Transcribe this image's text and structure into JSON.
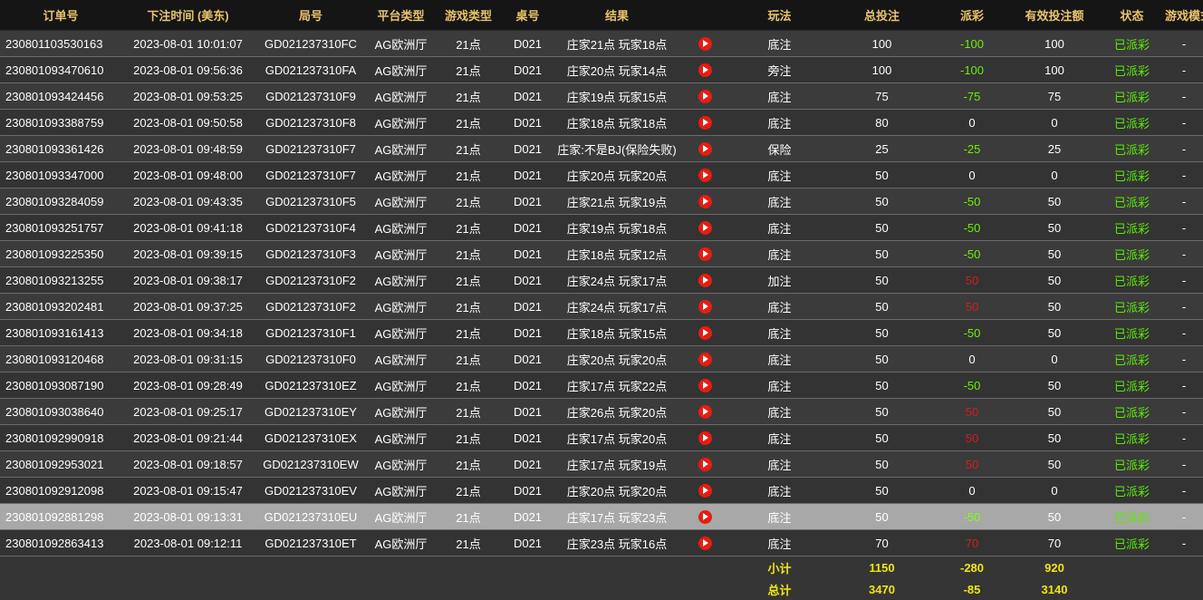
{
  "headers": {
    "order_id": "订单号",
    "bet_time": "下注时间 (美东)",
    "round_id": "局号",
    "platform": "平台类型",
    "game_type": "游戏类型",
    "table_no": "桌号",
    "result": "结果",
    "play": "玩法",
    "total_bet": "总投注",
    "payout": "派彩",
    "valid_bet": "有效投注额",
    "status": "状态",
    "game_mode": "游戏模式"
  },
  "rows": [
    {
      "order_id": "230801103530163",
      "bet_time": "2023-08-01 10:01:07",
      "round_id": "GD021237310FC",
      "platform": "AG欧洲厅",
      "game_type": "21点",
      "table_no": "D021",
      "result": "庄家21点 玩家18点",
      "play": "底注",
      "total_bet": "100",
      "payout": "-100",
      "payout_kind": "green",
      "valid_bet": "100",
      "status": "已派彩",
      "game_mode": "-"
    },
    {
      "order_id": "230801093470610",
      "bet_time": "2023-08-01 09:56:36",
      "round_id": "GD021237310FA",
      "platform": "AG欧洲厅",
      "game_type": "21点",
      "table_no": "D021",
      "result": "庄家20点 玩家14点",
      "play": "旁注",
      "total_bet": "100",
      "payout": "-100",
      "payout_kind": "green",
      "valid_bet": "100",
      "status": "已派彩",
      "game_mode": "-"
    },
    {
      "order_id": "230801093424456",
      "bet_time": "2023-08-01 09:53:25",
      "round_id": "GD021237310F9",
      "platform": "AG欧洲厅",
      "game_type": "21点",
      "table_no": "D021",
      "result": "庄家19点 玩家15点",
      "play": "底注",
      "total_bet": "75",
      "payout": "-75",
      "payout_kind": "green",
      "valid_bet": "75",
      "status": "已派彩",
      "game_mode": "-"
    },
    {
      "order_id": "230801093388759",
      "bet_time": "2023-08-01 09:50:58",
      "round_id": "GD021237310F8",
      "platform": "AG欧洲厅",
      "game_type": "21点",
      "table_no": "D021",
      "result": "庄家18点 玩家18点",
      "play": "底注",
      "total_bet": "80",
      "payout": "0",
      "payout_kind": "zero",
      "valid_bet": "0",
      "status": "已派彩",
      "game_mode": "-"
    },
    {
      "order_id": "230801093361426",
      "bet_time": "2023-08-01 09:48:59",
      "round_id": "GD021237310F7",
      "platform": "AG欧洲厅",
      "game_type": "21点",
      "table_no": "D021",
      "result": "庄家:不是BJ(保险失败)",
      "play": "保险",
      "total_bet": "25",
      "payout": "-25",
      "payout_kind": "green",
      "valid_bet": "25",
      "status": "已派彩",
      "game_mode": "-"
    },
    {
      "order_id": "230801093347000",
      "bet_time": "2023-08-01 09:48:00",
      "round_id": "GD021237310F7",
      "platform": "AG欧洲厅",
      "game_type": "21点",
      "table_no": "D021",
      "result": "庄家20点 玩家20点",
      "play": "底注",
      "total_bet": "50",
      "payout": "0",
      "payout_kind": "zero",
      "valid_bet": "0",
      "status": "已派彩",
      "game_mode": "-"
    },
    {
      "order_id": "230801093284059",
      "bet_time": "2023-08-01 09:43:35",
      "round_id": "GD021237310F5",
      "platform": "AG欧洲厅",
      "game_type": "21点",
      "table_no": "D021",
      "result": "庄家21点 玩家19点",
      "play": "底注",
      "total_bet": "50",
      "payout": "-50",
      "payout_kind": "green",
      "valid_bet": "50",
      "status": "已派彩",
      "game_mode": "-"
    },
    {
      "order_id": "230801093251757",
      "bet_time": "2023-08-01 09:41:18",
      "round_id": "GD021237310F4",
      "platform": "AG欧洲厅",
      "game_type": "21点",
      "table_no": "D021",
      "result": "庄家19点 玩家18点",
      "play": "底注",
      "total_bet": "50",
      "payout": "-50",
      "payout_kind": "green",
      "valid_bet": "50",
      "status": "已派彩",
      "game_mode": "-"
    },
    {
      "order_id": "230801093225350",
      "bet_time": "2023-08-01 09:39:15",
      "round_id": "GD021237310F3",
      "platform": "AG欧洲厅",
      "game_type": "21点",
      "table_no": "D021",
      "result": "庄家18点 玩家12点",
      "play": "底注",
      "total_bet": "50",
      "payout": "-50",
      "payout_kind": "green",
      "valid_bet": "50",
      "status": "已派彩",
      "game_mode": "-"
    },
    {
      "order_id": "230801093213255",
      "bet_time": "2023-08-01 09:38:17",
      "round_id": "GD021237310F2",
      "platform": "AG欧洲厅",
      "game_type": "21点",
      "table_no": "D021",
      "result": "庄家24点 玩家17点",
      "play": "加注",
      "total_bet": "50",
      "payout": "50",
      "payout_kind": "red",
      "valid_bet": "50",
      "status": "已派彩",
      "game_mode": "-"
    },
    {
      "order_id": "230801093202481",
      "bet_time": "2023-08-01 09:37:25",
      "round_id": "GD021237310F2",
      "platform": "AG欧洲厅",
      "game_type": "21点",
      "table_no": "D021",
      "result": "庄家24点 玩家17点",
      "play": "底注",
      "total_bet": "50",
      "payout": "50",
      "payout_kind": "red",
      "valid_bet": "50",
      "status": "已派彩",
      "game_mode": "-"
    },
    {
      "order_id": "230801093161413",
      "bet_time": "2023-08-01 09:34:18",
      "round_id": "GD021237310F1",
      "platform": "AG欧洲厅",
      "game_type": "21点",
      "table_no": "D021",
      "result": "庄家18点 玩家15点",
      "play": "底注",
      "total_bet": "50",
      "payout": "-50",
      "payout_kind": "green",
      "valid_bet": "50",
      "status": "已派彩",
      "game_mode": "-"
    },
    {
      "order_id": "230801093120468",
      "bet_time": "2023-08-01 09:31:15",
      "round_id": "GD021237310F0",
      "platform": "AG欧洲厅",
      "game_type": "21点",
      "table_no": "D021",
      "result": "庄家20点 玩家20点",
      "play": "底注",
      "total_bet": "50",
      "payout": "0",
      "payout_kind": "zero",
      "valid_bet": "0",
      "status": "已派彩",
      "game_mode": "-"
    },
    {
      "order_id": "230801093087190",
      "bet_time": "2023-08-01 09:28:49",
      "round_id": "GD021237310EZ",
      "platform": "AG欧洲厅",
      "game_type": "21点",
      "table_no": "D021",
      "result": "庄家17点 玩家22点",
      "play": "底注",
      "total_bet": "50",
      "payout": "-50",
      "payout_kind": "green",
      "valid_bet": "50",
      "status": "已派彩",
      "game_mode": "-"
    },
    {
      "order_id": "230801093038640",
      "bet_time": "2023-08-01 09:25:17",
      "round_id": "GD021237310EY",
      "platform": "AG欧洲厅",
      "game_type": "21点",
      "table_no": "D021",
      "result": "庄家26点 玩家20点",
      "play": "底注",
      "total_bet": "50",
      "payout": "50",
      "payout_kind": "red",
      "valid_bet": "50",
      "status": "已派彩",
      "game_mode": "-"
    },
    {
      "order_id": "230801092990918",
      "bet_time": "2023-08-01 09:21:44",
      "round_id": "GD021237310EX",
      "platform": "AG欧洲厅",
      "game_type": "21点",
      "table_no": "D021",
      "result": "庄家17点 玩家20点",
      "play": "底注",
      "total_bet": "50",
      "payout": "50",
      "payout_kind": "red",
      "valid_bet": "50",
      "status": "已派彩",
      "game_mode": "-"
    },
    {
      "order_id": "230801092953021",
      "bet_time": "2023-08-01 09:18:57",
      "round_id": "GD021237310EW",
      "platform": "AG欧洲厅",
      "game_type": "21点",
      "table_no": "D021",
      "result": "庄家17点 玩家19点",
      "play": "底注",
      "total_bet": "50",
      "payout": "50",
      "payout_kind": "red",
      "valid_bet": "50",
      "status": "已派彩",
      "game_mode": "-"
    },
    {
      "order_id": "230801092912098",
      "bet_time": "2023-08-01 09:15:47",
      "round_id": "GD021237310EV",
      "platform": "AG欧洲厅",
      "game_type": "21点",
      "table_no": "D021",
      "result": "庄家20点 玩家20点",
      "play": "底注",
      "total_bet": "50",
      "payout": "0",
      "payout_kind": "zero",
      "valid_bet": "0",
      "status": "已派彩",
      "game_mode": "-"
    },
    {
      "order_id": "230801092881298",
      "bet_time": "2023-08-01 09:13:31",
      "round_id": "GD021237310EU",
      "platform": "AG欧洲厅",
      "game_type": "21点",
      "table_no": "D021",
      "result": "庄家17点 玩家23点",
      "play": "底注",
      "total_bet": "50",
      "payout": "-50",
      "payout_kind": "green",
      "valid_bet": "50",
      "status": "已派彩",
      "game_mode": "-",
      "highlight": true
    },
    {
      "order_id": "230801092863413",
      "bet_time": "2023-08-01 09:12:11",
      "round_id": "GD021237310ET",
      "platform": "AG欧洲厅",
      "game_type": "21点",
      "table_no": "D021",
      "result": "庄家23点 玩家16点",
      "play": "底注",
      "total_bet": "70",
      "payout": "70",
      "payout_kind": "red",
      "valid_bet": "70",
      "status": "已派彩",
      "game_mode": "-"
    }
  ],
  "subtotal": {
    "label": "小计",
    "total_bet": "1150",
    "payout": "-280",
    "valid_bet": "920"
  },
  "grandtotal": {
    "label": "总计",
    "total_bet": "3470",
    "payout": "-85",
    "valid_bet": "3140"
  },
  "colors": {
    "header_text": "#e9c368",
    "payout_negative": "#6cf000",
    "payout_positive": "#d41d1d",
    "status": "#58ec00",
    "totals": "#f2e60a",
    "replay_icon": "#e81c10"
  },
  "icons": {
    "replay": "play-icon"
  }
}
